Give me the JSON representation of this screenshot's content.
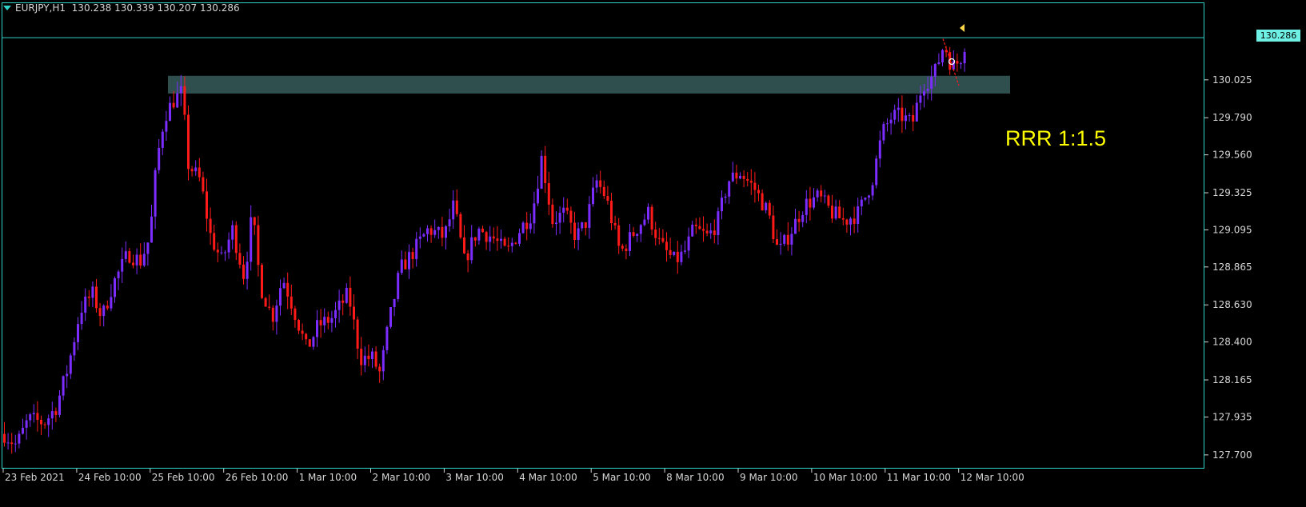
{
  "header": {
    "symbol": "EURJPY,H1",
    "ohlc": "130.238 130.339 130.207 130.286"
  },
  "annotation": {
    "text": "RRR 1:1.5",
    "color": "#ffff00"
  },
  "current_price": "130.286",
  "colors": {
    "background": "#000000",
    "frame": "#2fd3c8",
    "bull_candle": "#7b2cff",
    "bear_candle": "#ff1a1a",
    "zone": "#2f4f4f",
    "price_line": "#2fd3c8",
    "axis_text": "#d6d6d6"
  },
  "chart_data": {
    "type": "candlestick",
    "timeframe": "H1",
    "y_ticks": [
      "130.025",
      "129.790",
      "129.560",
      "129.325",
      "129.095",
      "128.865",
      "128.630",
      "128.400",
      "128.165",
      "127.935",
      "127.700"
    ],
    "ylim": [
      127.62,
      130.5
    ],
    "x_labels": [
      "23 Feb 2021",
      "24 Feb 10:00",
      "25 Feb 10:00",
      "26 Feb 10:00",
      "1 Mar 10:00",
      "2 Mar 10:00",
      "3 Mar 10:00",
      "4 Mar 10:00",
      "5 Mar 10:00",
      "8 Mar 10:00",
      "9 Mar 10:00",
      "10 Mar 10:00",
      "11 Mar 10:00",
      "12 Mar 10:00"
    ],
    "zone": {
      "low": 129.94,
      "high": 130.05
    },
    "close_path": [
      {
        "t": 0,
        "p": 127.83
      },
      {
        "t": 15,
        "p": 127.76
      },
      {
        "t": 30,
        "p": 127.92
      },
      {
        "t": 50,
        "p": 127.9
      },
      {
        "t": 65,
        "p": 128.0
      },
      {
        "t": 80,
        "p": 128.25
      },
      {
        "t": 95,
        "p": 128.6
      },
      {
        "t": 110,
        "p": 128.7
      },
      {
        "t": 122,
        "p": 128.55
      },
      {
        "t": 135,
        "p": 128.75
      },
      {
        "t": 155,
        "p": 128.95
      },
      {
        "t": 170,
        "p": 128.9
      },
      {
        "t": 182,
        "p": 129.05
      },
      {
        "t": 190,
        "p": 129.5
      },
      {
        "t": 200,
        "p": 129.8
      },
      {
        "t": 212,
        "p": 129.9
      },
      {
        "t": 222,
        "p": 129.95
      },
      {
        "t": 230,
        "p": 129.5
      },
      {
        "t": 245,
        "p": 129.4
      },
      {
        "t": 258,
        "p": 129.05
      },
      {
        "t": 272,
        "p": 128.9
      },
      {
        "t": 285,
        "p": 129.1
      },
      {
        "t": 300,
        "p": 128.8
      },
      {
        "t": 310,
        "p": 129.2
      },
      {
        "t": 320,
        "p": 128.75
      },
      {
        "t": 335,
        "p": 128.55
      },
      {
        "t": 348,
        "p": 128.8
      },
      {
        "t": 362,
        "p": 128.6
      },
      {
        "t": 378,
        "p": 128.35
      },
      {
        "t": 392,
        "p": 128.5
      },
      {
        "t": 410,
        "p": 128.55
      },
      {
        "t": 430,
        "p": 128.7
      },
      {
        "t": 445,
        "p": 128.3
      },
      {
        "t": 460,
        "p": 128.3
      },
      {
        "t": 470,
        "p": 128.2
      },
      {
        "t": 480,
        "p": 128.5
      },
      {
        "t": 495,
        "p": 128.85
      },
      {
        "t": 510,
        "p": 128.95
      },
      {
        "t": 530,
        "p": 129.1
      },
      {
        "t": 550,
        "p": 129.05
      },
      {
        "t": 562,
        "p": 129.25
      },
      {
        "t": 575,
        "p": 128.9
      },
      {
        "t": 592,
        "p": 129.1
      },
      {
        "t": 610,
        "p": 129.05
      },
      {
        "t": 628,
        "p": 128.95
      },
      {
        "t": 645,
        "p": 129.1
      },
      {
        "t": 660,
        "p": 129.2
      },
      {
        "t": 672,
        "p": 129.55
      },
      {
        "t": 685,
        "p": 129.15
      },
      {
        "t": 700,
        "p": 129.2
      },
      {
        "t": 715,
        "p": 129.05
      },
      {
        "t": 728,
        "p": 129.15
      },
      {
        "t": 740,
        "p": 129.4
      },
      {
        "t": 752,
        "p": 129.3
      },
      {
        "t": 770,
        "p": 128.95
      },
      {
        "t": 790,
        "p": 129.1
      },
      {
        "t": 805,
        "p": 129.2
      },
      {
        "t": 820,
        "p": 129.0
      },
      {
        "t": 838,
        "p": 128.9
      },
      {
        "t": 850,
        "p": 128.95
      },
      {
        "t": 862,
        "p": 129.1
      },
      {
        "t": 880,
        "p": 129.05
      },
      {
        "t": 892,
        "p": 129.15
      },
      {
        "t": 905,
        "p": 129.4
      },
      {
        "t": 920,
        "p": 129.45
      },
      {
        "t": 938,
        "p": 129.35
      },
      {
        "t": 955,
        "p": 129.2
      },
      {
        "t": 968,
        "p": 128.95
      },
      {
        "t": 985,
        "p": 129.1
      },
      {
        "t": 1000,
        "p": 129.25
      },
      {
        "t": 1018,
        "p": 129.3
      },
      {
        "t": 1035,
        "p": 129.2
      },
      {
        "t": 1050,
        "p": 129.15
      },
      {
        "t": 1068,
        "p": 129.2
      },
      {
        "t": 1085,
        "p": 129.4
      },
      {
        "t": 1098,
        "p": 129.7
      },
      {
        "t": 1110,
        "p": 129.8
      },
      {
        "t": 1122,
        "p": 129.8
      },
      {
        "t": 1135,
        "p": 129.75
      },
      {
        "t": 1148,
        "p": 130.0
      },
      {
        "t": 1162,
        "p": 130.05
      },
      {
        "t": 1175,
        "p": 130.25
      },
      {
        "t": 1185,
        "p": 130.1
      },
      {
        "t": 1195,
        "p": 130.15
      },
      {
        "t": 1203,
        "p": 130.29
      }
    ],
    "trade_markers": [
      {
        "kind": "entry",
        "t": 1175,
        "p": 130.28,
        "color": "#ff1a1a"
      },
      {
        "kind": "exit",
        "t": 1195,
        "p": 129.99,
        "color": "#ff1a1a"
      }
    ]
  }
}
